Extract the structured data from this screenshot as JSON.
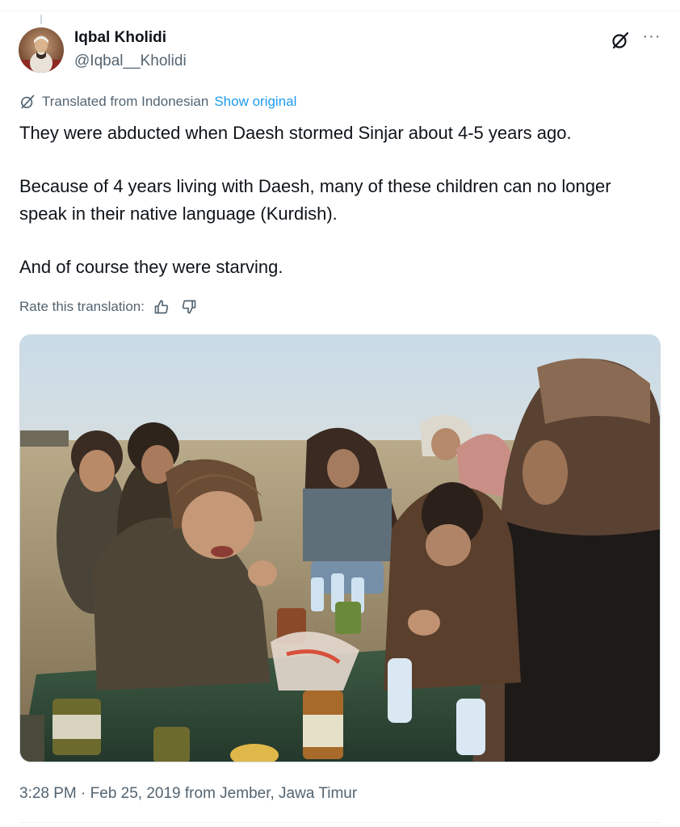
{
  "author": {
    "display_name": "Iqbal Kholidi",
    "handle": "@Iqbal__Kholidi"
  },
  "icons": {
    "grok": "grok-icon",
    "more": "more-icon",
    "translate": "translate-icon",
    "thumb_up": "thumb-up-icon",
    "thumb_down": "thumb-down-icon"
  },
  "more_label": "···",
  "translation": {
    "label": "Translated from Indonesian",
    "show_original": "Show original",
    "rate_label": "Rate this translation:"
  },
  "tweet": {
    "paragraphs": [
      "They were abducted when Daesh stormed Sinjar about 4-5 years ago.",
      "Because of 4 years living with Daesh, many of these children can no longer speak in their native language (Kurdish).",
      "And of course they were starving."
    ]
  },
  "meta": {
    "timestamp": "3:28 PM · Feb 25, 2019 from Jember, Jawa Timur"
  },
  "colors": {
    "text": "#0f1419",
    "secondary": "#536471",
    "link": "#1d9bf0",
    "border": "#cfd9de"
  }
}
